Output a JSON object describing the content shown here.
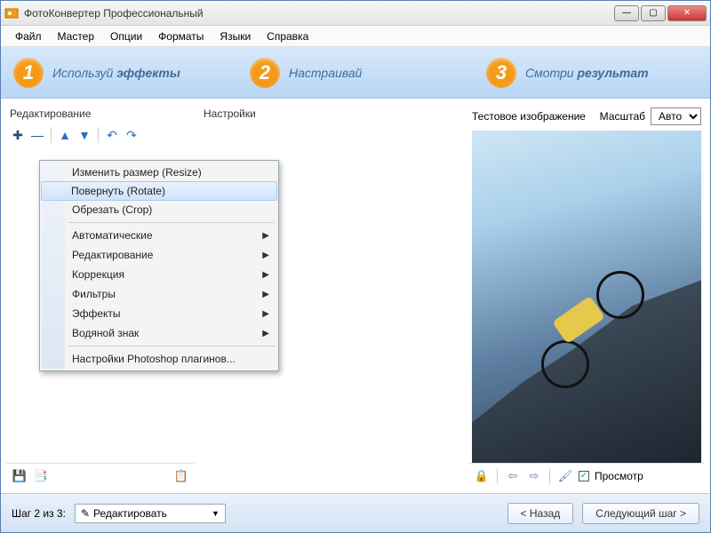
{
  "window": {
    "title": "ФотоКонвертер Профессиональный"
  },
  "menubar": [
    "Файл",
    "Мастер",
    "Опции",
    "Форматы",
    "Языки",
    "Справка"
  ],
  "banner": {
    "step1": {
      "num": "1",
      "prefix": "Используй ",
      "bold": "эффекты"
    },
    "step2": {
      "num": "2",
      "label": "Настраивай"
    },
    "step3": {
      "num": "3",
      "prefix": "Смотри ",
      "bold": "результат"
    }
  },
  "panels": {
    "left_title": "Редактирование",
    "mid_title": "Настройки",
    "right_title": "Тестовое изображение",
    "zoom_label": "Масштаб",
    "zoom_value": "Авто"
  },
  "context_menu": {
    "items": [
      {
        "label": "Изменить размер (Resize)",
        "submenu": false
      },
      {
        "label": "Повернуть (Rotate)",
        "submenu": false,
        "hover": true
      },
      {
        "label": "Обрезать (Crop)",
        "submenu": false
      },
      {
        "sep": true
      },
      {
        "label": "Автоматические",
        "submenu": true
      },
      {
        "label": "Редактирование",
        "submenu": true
      },
      {
        "label": "Коррекция",
        "submenu": true
      },
      {
        "label": "Фильтры",
        "submenu": true
      },
      {
        "label": "Эффекты",
        "submenu": true
      },
      {
        "label": "Водяной знак",
        "submenu": true
      },
      {
        "sep": true
      },
      {
        "label": "Настройки Photoshop плагинов...",
        "submenu": false
      }
    ]
  },
  "preview": {
    "checkbox_label": "Просмотр",
    "checked": true
  },
  "footer": {
    "step_text": "Шаг 2 из 3:",
    "combo_value": "Редактировать",
    "back": "< Назад",
    "next": "Следующий шаг >"
  }
}
